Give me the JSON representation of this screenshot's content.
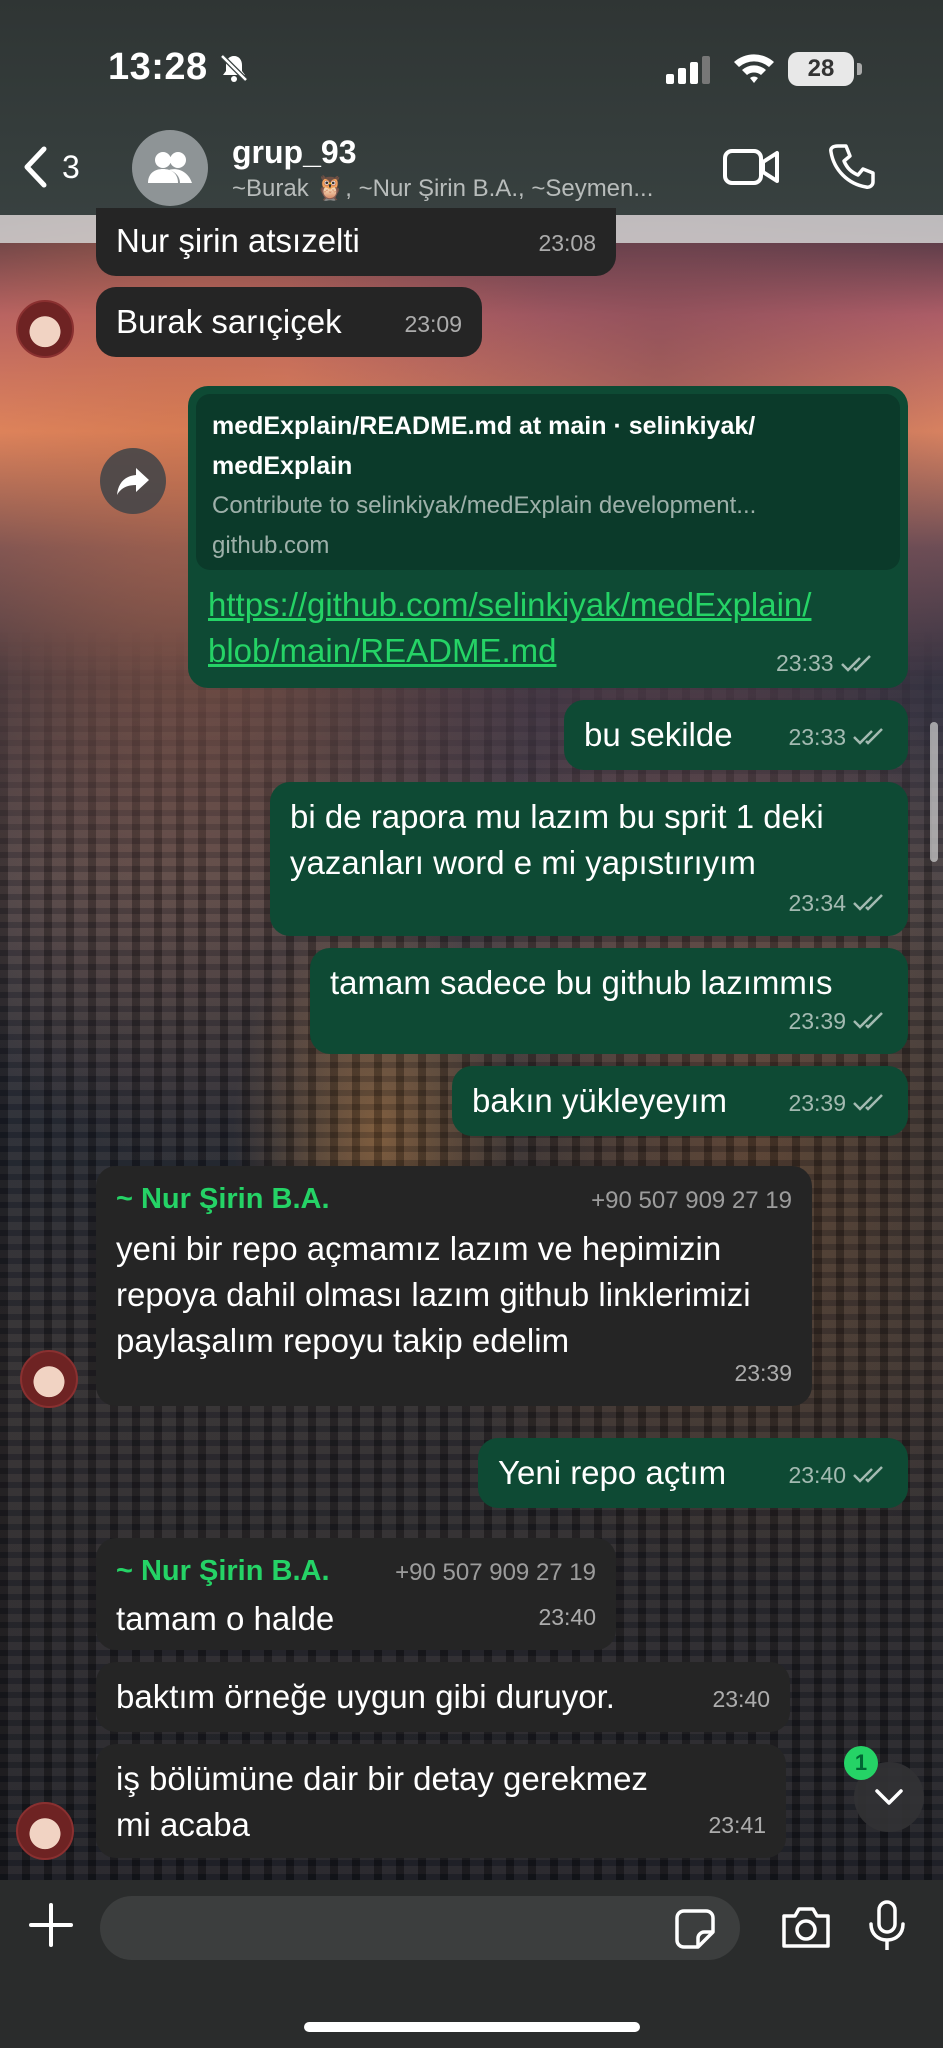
{
  "status_bar": {
    "time": "13:28",
    "battery": "28"
  },
  "header": {
    "back_count": "3",
    "group_name": "grup_93",
    "members": "~Burak 🦉, ~Nur Şirin B.A., ~Seymen..."
  },
  "messages": [
    {
      "text": "Nur şirin atsızelti",
      "time": "23:08"
    },
    {
      "text": "Burak sarıçiçek",
      "time": "23:09"
    },
    {
      "preview_title": "medExplain/README.md at main · selinkiyak/ medExplain",
      "preview_desc": "Contribute to selinkiyak/medExplain development...",
      "preview_domain": "github.com",
      "link": "https://github.com/selinkiyak/medExplain/ blob/main/README.md",
      "time": "23:33"
    },
    {
      "text": "bu sekilde",
      "time": "23:33"
    },
    {
      "text": "bi de rapora mu lazım bu sprit 1 deki yazanları word e mi yapıstırıyım",
      "time": "23:34"
    },
    {
      "text": "tamam sadece bu github lazımmıs",
      "time": "23:39"
    },
    {
      "text": "bakın yükleyeyım",
      "time": "23:39"
    },
    {
      "sender": "~ Nur Şirin B.A.",
      "phone": "+90 507 909 27 19",
      "text": "yeni bir repo açmamız lazım ve hepimizin repoya dahil olması lazım github linklerimizi paylaşalım repoyu takip edelim",
      "time": "23:39"
    },
    {
      "text": "Yeni repo açtım",
      "time": "23:40"
    },
    {
      "sender": "~ Nur Şirin B.A.",
      "phone": "+90 507 909 27 19",
      "text": "tamam o halde",
      "time": "23:40"
    },
    {
      "text": "baktım örneğe uygun gibi duruyor.",
      "time": "23:40"
    },
    {
      "text": "iş bölümüne dair bir detay gerekmez mi acaba",
      "time": "23:41"
    }
  ],
  "unread_count": "1",
  "input": {
    "placeholder": ""
  },
  "colors": {
    "outgoing": "#0e4a34",
    "incoming": "#252525",
    "accent": "#25d366"
  }
}
